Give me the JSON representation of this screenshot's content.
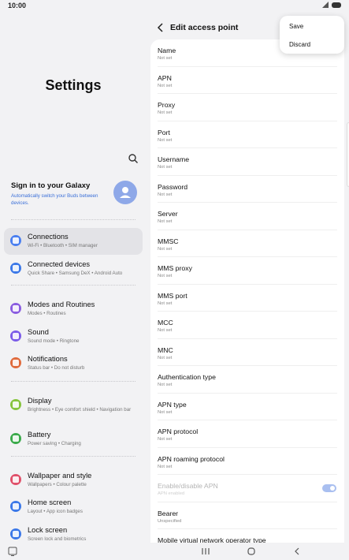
{
  "status_bar": {
    "time": "10:00",
    "signal_icon": "signal-icon",
    "battery_icon": "battery-icon"
  },
  "left": {
    "title": "Settings",
    "search_icon": "search-icon",
    "account": {
      "title": "Sign in to your Galaxy",
      "subtitle": "Automatically switch your Buds between devices.",
      "avatar_icon": "person-icon"
    },
    "items": [
      {
        "label": "Connections",
        "sub": "Wi-Fi  •  Bluetooth  •  SIM manager",
        "icon": "wifi-icon",
        "color": "#4a7ff0",
        "selected": true
      },
      {
        "label": "Connected devices",
        "sub": "Quick Share  •  Samsung DeX  •  Android Auto",
        "icon": "devices-icon",
        "color": "#3b78e8"
      },
      {
        "label": "Modes and Routines",
        "sub": "Modes  •  Routines",
        "icon": "check-circle-icon",
        "color": "#8a5ce0"
      },
      {
        "label": "Sound",
        "sub": "Sound mode  •  Ringtone",
        "icon": "speaker-icon",
        "color": "#7b5ce8"
      },
      {
        "label": "Notifications",
        "sub": "Status bar  •  Do not disturb",
        "icon": "bell-icon",
        "color": "#e06a3c"
      },
      {
        "label": "Display",
        "sub": "Brightness  •  Eye comfort shield  •  Navigation bar",
        "icon": "sun-icon",
        "color": "#86c43c"
      },
      {
        "label": "Battery",
        "sub": "Power saving  •  Charging",
        "icon": "battery-circle-icon",
        "color": "#3aaa4a"
      },
      {
        "label": "Wallpaper and style",
        "sub": "Wallpapers  •  Colour palette",
        "icon": "image-icon",
        "color": "#e0506a"
      },
      {
        "label": "Home screen",
        "sub": "Layout  •  App icon badges",
        "icon": "home-icon",
        "color": "#3b78e8"
      },
      {
        "label": "Lock screen",
        "sub": "Screen lock and biometrics",
        "icon": "lock-icon",
        "color": "#3b78e8"
      }
    ]
  },
  "right": {
    "back_icon": "chevron-left-icon",
    "title": "Edit access point",
    "fields": [
      {
        "label": "Name",
        "value": "Not set"
      },
      {
        "label": "APN",
        "value": "Not set"
      },
      {
        "label": "Proxy",
        "value": "Not set"
      },
      {
        "label": "Port",
        "value": "Not set"
      },
      {
        "label": "Username",
        "value": "Not set"
      },
      {
        "label": "Password",
        "value": "Not set"
      },
      {
        "label": "Server",
        "value": "Not set"
      },
      {
        "label": "MMSC",
        "value": "Not set"
      },
      {
        "label": "MMS proxy",
        "value": "Not set"
      },
      {
        "label": "MMS port",
        "value": "Not set"
      },
      {
        "label": "MCC",
        "value": "Not set"
      },
      {
        "label": "MNC",
        "value": "Not set"
      },
      {
        "label": "Authentication type",
        "value": "Not set"
      },
      {
        "label": "APN type",
        "value": "Not set"
      },
      {
        "label": "APN protocol",
        "value": "Not set"
      },
      {
        "label": "APN roaming protocol",
        "value": "Not set"
      },
      {
        "label": "Enable/disable APN",
        "value": "APN enabled",
        "disabled": true,
        "toggle_on": true
      },
      {
        "label": "Bearer",
        "value": "Unspecified"
      },
      {
        "label": "Mobile virtual network operator type",
        "value": ""
      }
    ]
  },
  "popup": {
    "items": [
      "Save",
      "Discard"
    ]
  },
  "nav": {
    "recent_icon": "recents-icon",
    "home_icon": "home-circle-icon",
    "back_icon": "back-chevron-icon",
    "keyboard_icon": "keyboard-icon"
  }
}
